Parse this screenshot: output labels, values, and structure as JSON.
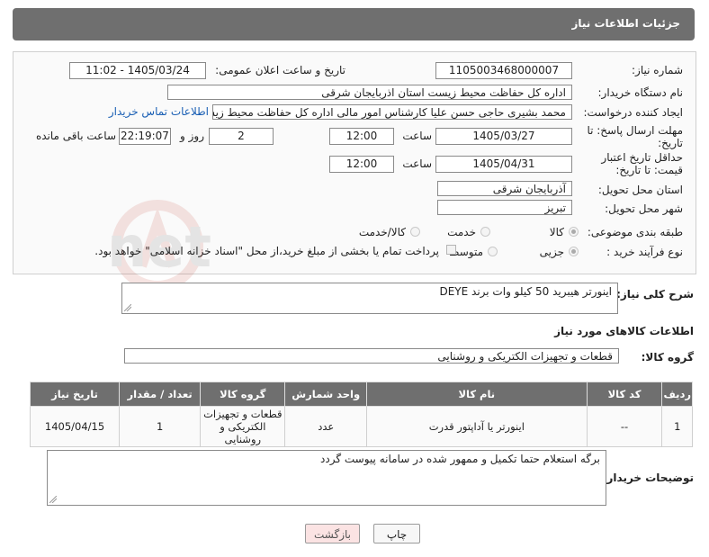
{
  "header": {
    "title": "جزئیات اطلاعات نیاز"
  },
  "form": {
    "need_number_label": "شماره نیاز:",
    "need_number": "1105003468000007",
    "announce_label": "تاریخ و ساعت اعلان عمومی:",
    "announce_value": "1405/03/24 - 11:02",
    "buyer_org_label": "نام دستگاه خریدار:",
    "buyer_org": "اداره کل حفاظت محیط زیست استان اذربایجان شرقی",
    "creator_label": "ایجاد کننده درخواست:",
    "creator": "محمد بشیری حاجی حسن علیا کارشناس امور مالی اداره کل حفاظت محیط زیس",
    "contact_link": "اطلاعات تماس خریدار",
    "reply_deadline_label": "مهلت ارسال پاسخ: تا تاریخ:",
    "reply_date": "1405/03/27",
    "time_label": "ساعت",
    "reply_time": "12:00",
    "days_value": "2",
    "days_label": "روز و",
    "remaining_time": "22:19:07",
    "remaining_label": "ساعت باقی مانده",
    "price_validity_label": "حداقل تاریخ اعتبار قیمت: تا تاریخ:",
    "price_date": "1405/04/31",
    "price_time": "12:00",
    "province_label": "استان محل تحویل:",
    "province": "آذربایجان شرقی",
    "city_label": "شهر محل تحویل:",
    "city": "تبریز",
    "category_label": "طبقه بندی موضوعی:",
    "category_options": [
      "کالا",
      "خدمت",
      "کالا/خدمت"
    ],
    "category_selected": "کالا",
    "process_label": "نوع فرآیند خرید :",
    "process_options": [
      "جزیی",
      "متوسط"
    ],
    "process_selected": "جزیی",
    "payment_note": "پرداخت تمام یا بخشی از مبلغ خرید،از محل \"اسناد خزانه اسلامی\" خواهد بود."
  },
  "description": {
    "label": "شرح کلی نیاز:",
    "value": "اینورتر هیبرید 50 کیلو وات برند DEYE"
  },
  "goods_section": {
    "title": "اطلاعات کالاهای مورد نیاز",
    "group_label": "گروه کالا:",
    "group_value": "قطعات و تجهیزات الکتریکی و روشنایی"
  },
  "table": {
    "headers": [
      "ردیف",
      "کد کالا",
      "نام کالا",
      "واحد شمارش",
      "گروه کالا",
      "تعداد / مقدار",
      "تاریخ نیاز"
    ],
    "rows": [
      {
        "row": "1",
        "code": "--",
        "name": "اینورتر یا آداپتور قدرت",
        "unit": "عدد",
        "group": "قطعات و تجهیزات الکتریکی و روشنایی",
        "qty": "1",
        "date": "1405/04/15"
      }
    ]
  },
  "buyer_notes": {
    "label": "توضیحات خریدار:",
    "value": "برگه استعلام حتما تکمیل و ممهور شده در سامانه پیوست گردد"
  },
  "buttons": {
    "print": "چاپ",
    "back": "بازگشت"
  },
  "watermark_text": "AriaTender.net",
  "colors": {
    "header_bg": "#6f6f6f",
    "link": "#1a5fb4",
    "back_button_bg": "#fbe3e3"
  }
}
